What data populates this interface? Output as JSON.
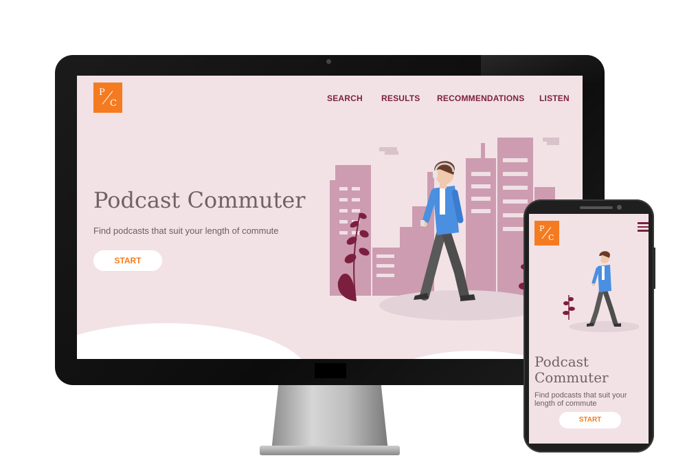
{
  "brand": {
    "letter_top": "P",
    "letter_bottom": "C",
    "color": "#f47b20"
  },
  "nav": {
    "items": [
      {
        "label": "SEARCH"
      },
      {
        "label": "RESULTS"
      },
      {
        "label": "RECOMMENDATIONS"
      },
      {
        "label": "LISTEN"
      }
    ],
    "color": "#7b1f3e"
  },
  "hero": {
    "title": "Podcast Commuter",
    "subtitle": "Find podcasts that suit your length of commute",
    "cta_label": "START"
  },
  "mobile": {
    "title": "Podcast Commuter",
    "subtitle": "Find podcasts that suit your length of commute",
    "cta_label": "START",
    "menu_icon": "hamburger-menu-icon"
  },
  "colors": {
    "page_background": "#f2e2e6",
    "accent": "#f47b20",
    "buildings": "#cd9cb0",
    "plant": "#7b1f3e",
    "shirt": "#4a8fe0",
    "pants": "#555555"
  }
}
